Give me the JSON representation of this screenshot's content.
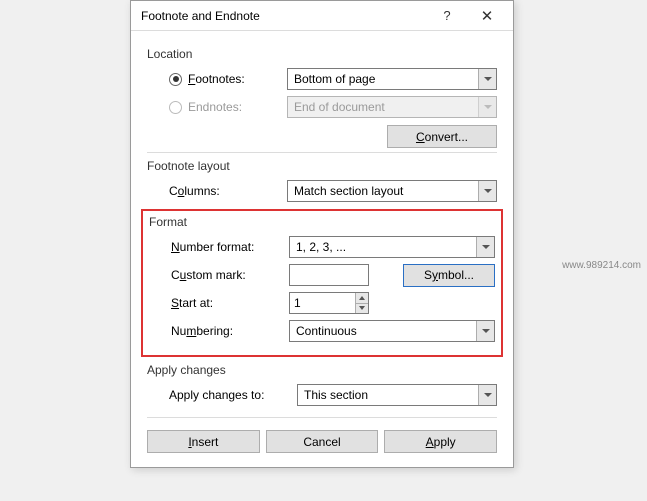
{
  "dialog": {
    "title": "Footnote and Endnote"
  },
  "sections": {
    "location": "Location",
    "footnote_layout": "Footnote layout",
    "format": "Format",
    "apply_changes": "Apply changes"
  },
  "location": {
    "footnotes_label": "Footnotes:",
    "footnotes_value": "Bottom of page",
    "endnotes_label": "Endnotes:",
    "endnotes_value": "End of document",
    "convert_label": "Convert..."
  },
  "layout": {
    "columns_label": "Columns:",
    "columns_value": "Match section layout"
  },
  "format": {
    "number_format_label": "Number format:",
    "number_format_value": "1, 2, 3, ...",
    "custom_mark_label": "Custom mark:",
    "custom_mark_value": "",
    "symbol_label": "Symbol...",
    "start_at_label": "Start at:",
    "start_at_value": "1",
    "numbering_label": "Numbering:",
    "numbering_value": "Continuous"
  },
  "apply": {
    "apply_to_label": "Apply changes to:",
    "apply_to_value": "This section"
  },
  "buttons": {
    "insert": "Insert",
    "cancel": "Cancel",
    "apply": "Apply"
  },
  "watermark": "www.989214.com"
}
